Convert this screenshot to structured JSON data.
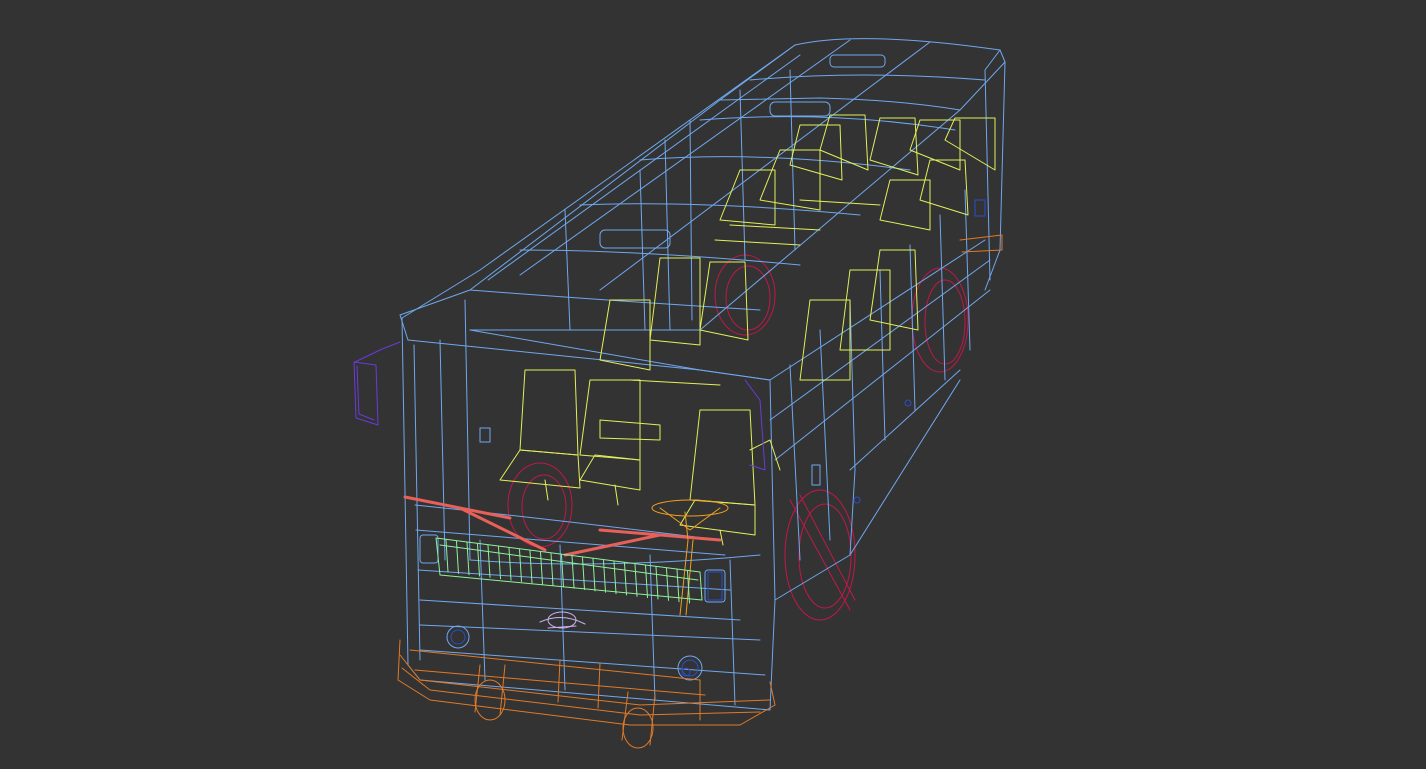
{
  "viewport": {
    "background": "#333333",
    "colors": {
      "body": "#6fa8ee",
      "seats": "#e2f05a",
      "wheels": "#c0184a",
      "bumper": "#e07a28",
      "grille": "#8ff29a",
      "mirror": "#6a3bd8",
      "wipers": "#e8605a",
      "steering": "#f0a020",
      "lights": "#2a4ec8",
      "emblem": "#c8b4f0"
    },
    "icons": [
      "bus-wireframe-icon"
    ]
  }
}
